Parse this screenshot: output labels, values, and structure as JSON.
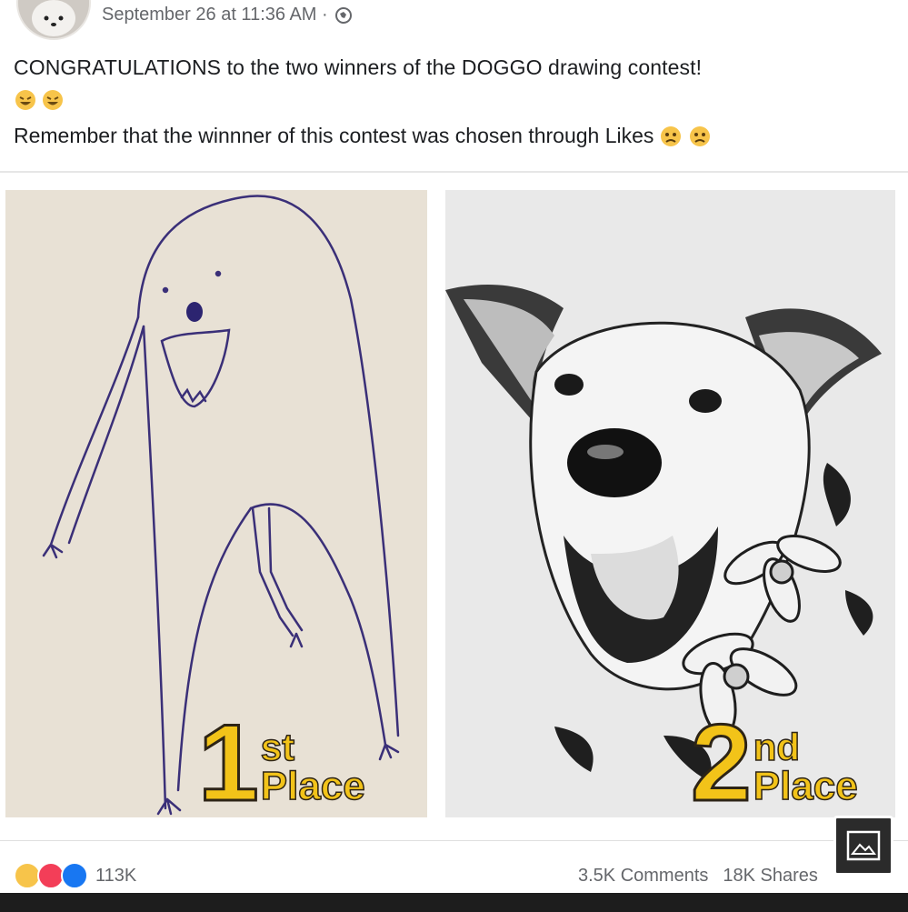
{
  "post": {
    "timestamp": "September 26 at 11:36 AM ·",
    "caption_line1": "CONGRATULATIONS to the two winners of the DOGGO drawing contest!",
    "caption_line2": "Remember that the winnner of this contest was chosen through Likes"
  },
  "photos": [
    {
      "place_number": "1",
      "place_suffix": "st",
      "place_word": "Place"
    },
    {
      "place_number": "2",
      "place_suffix": "nd",
      "place_word": "Place"
    }
  ],
  "footer": {
    "reaction_count": "113K",
    "comments": "3.5K Comments",
    "shares": "18K Shares"
  },
  "icons": {
    "globe": "globe-icon",
    "emoji_laugh": "laughing-emoji-icon",
    "emoji_sad": "sad-emoji-icon",
    "reaction_haha": "haha-reaction-icon",
    "reaction_love": "love-reaction-icon",
    "reaction_like": "like-reaction-icon",
    "image_button": "image-icon"
  },
  "colors": {
    "meta_text": "#65676b",
    "place_gold": "#f2c319",
    "like_blue": "#1877f2",
    "love_red": "#f33e58"
  }
}
